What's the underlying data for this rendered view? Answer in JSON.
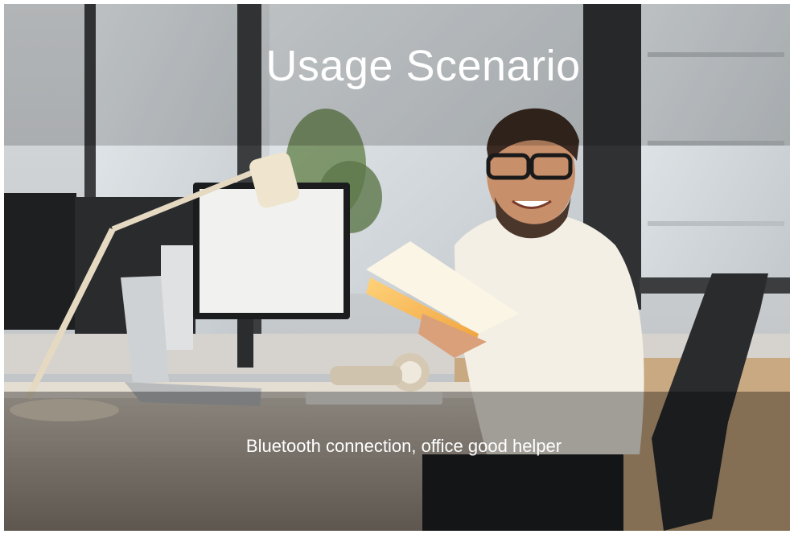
{
  "banner": {
    "title": "Usage Scenario",
    "caption": "Bluetooth connection, office good helper"
  },
  "photo": {
    "subject": "man-reading-book-at-office-desk-icon"
  }
}
